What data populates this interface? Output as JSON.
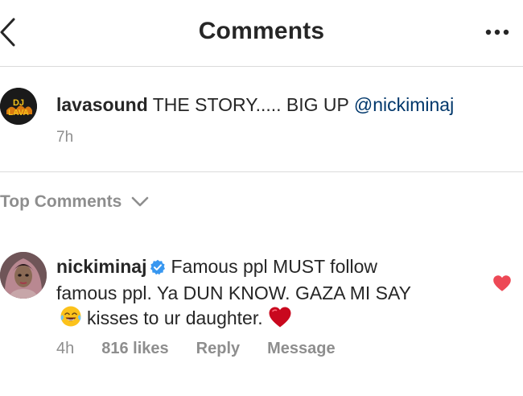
{
  "header": {
    "title": "Comments",
    "back_icon": "chevron-left-icon",
    "more_icon": "more-horizontal-icon"
  },
  "caption": {
    "username": "lavasound",
    "text": "THE STORY..... BIG UP",
    "mention": "@nickiminaj",
    "time": "7h",
    "avatar_text_top": "DJ",
    "avatar_text_bottom": "LAVA"
  },
  "filter": {
    "label": "Top Comments",
    "icon": "chevron-down-icon"
  },
  "comment": {
    "username": "nickiminaj",
    "verified": true,
    "text_part1": "Famous ppl MUST follow famous ppl. Ya DUN KNOW. GAZA MI SAY",
    "text_part2": "kisses to ur daughter.",
    "time": "4h",
    "likes": "816 likes",
    "reply_label": "Reply",
    "message_label": "Message",
    "liked": true
  },
  "colors": {
    "text": "#262626",
    "secondary": "#8e8e8e",
    "link": "#00376b",
    "verified": "#3897f0",
    "like": "#ed4956",
    "divider": "#dbdbdb"
  }
}
